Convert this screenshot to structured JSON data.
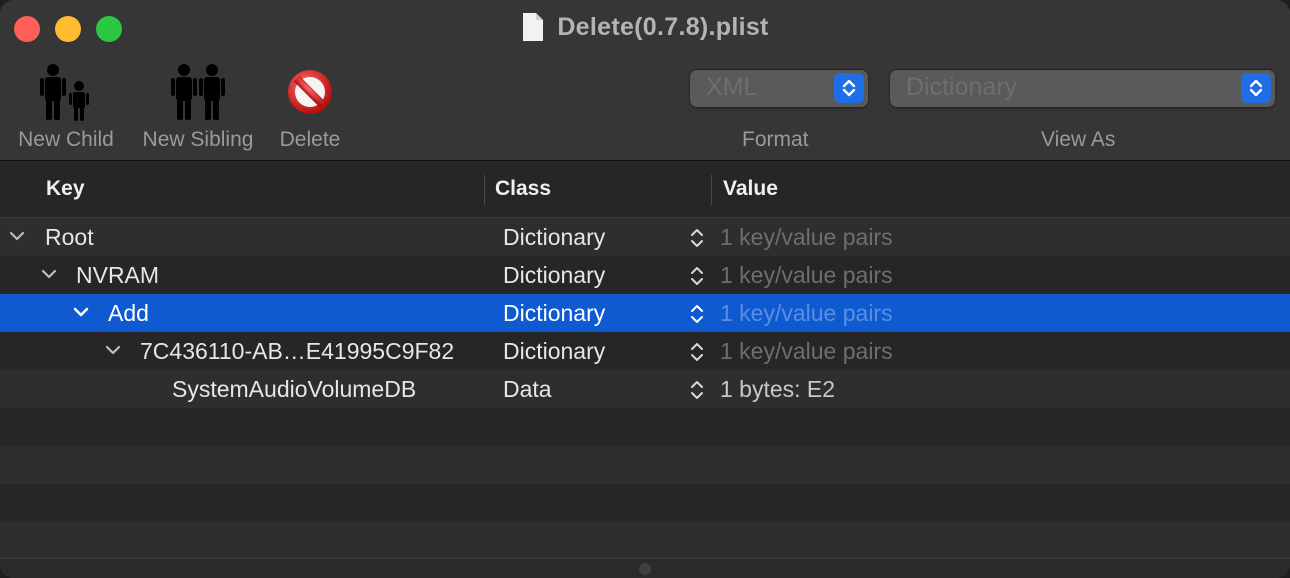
{
  "window": {
    "title": "Delete(0.7.8).plist"
  },
  "toolbar": {
    "new_child_label": "New Child",
    "new_sibling_label": "New Sibling",
    "delete_label": "Delete",
    "format_value": "XML",
    "format_label": "Format",
    "view_as_value": "Dictionary",
    "view_as_label": "View As"
  },
  "columns": {
    "key": "Key",
    "class": "Class",
    "value": "Value"
  },
  "rows": [
    {
      "key": "Root",
      "class": "Dictionary",
      "value": "1 key/value pairs",
      "expanded": true,
      "selected": false
    },
    {
      "key": "NVRAM",
      "class": "Dictionary",
      "value": "1 key/value pairs",
      "expanded": true,
      "selected": false
    },
    {
      "key": "Add",
      "class": "Dictionary",
      "value": "1 key/value pairs",
      "expanded": true,
      "selected": true
    },
    {
      "key": "7C436110-AB…E41995C9F82",
      "class": "Dictionary",
      "value": "1 key/value pairs",
      "expanded": true,
      "selected": false
    },
    {
      "key": "SystemAudioVolumeDB",
      "class": "Data",
      "value": "1 bytes: E2",
      "expanded": false,
      "selected": false
    }
  ],
  "colors": {
    "selection": "#0f5ad0",
    "popup_accent": "#1f6ee6",
    "close": "#fe5f57",
    "minimize": "#febc2e",
    "maximize": "#28c840"
  }
}
